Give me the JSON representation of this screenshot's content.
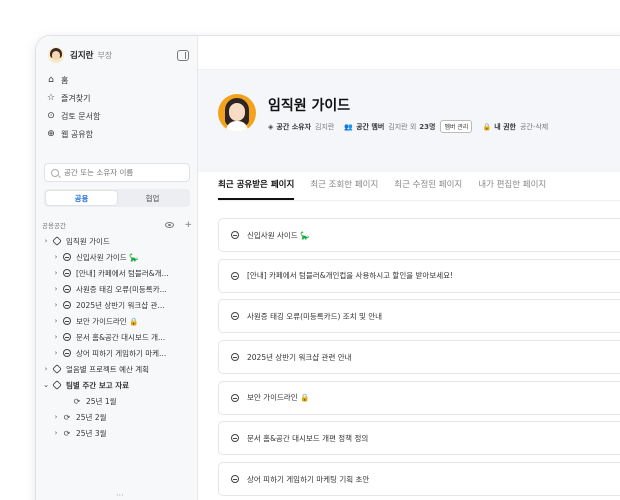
{
  "user": {
    "name": "김지란",
    "title": "부장"
  },
  "nav": [
    {
      "icon": "home-icon",
      "label": "홈"
    },
    {
      "icon": "star-icon",
      "label": "즐겨찾기"
    },
    {
      "icon": "review-icon",
      "label": "검토 문서함"
    },
    {
      "icon": "web-share-icon",
      "label": "웹 공유함"
    }
  ],
  "search": {
    "placeholder": "공간 또는 소유자 이름"
  },
  "segment": {
    "public": "공용",
    "collab": "협업"
  },
  "space_header": "공용공간",
  "tree": [
    {
      "label": "임직원 가이드",
      "chev": "›",
      "icon": "cube"
    },
    {
      "label": "신입사원 가이드 🦕",
      "chev": "›",
      "icon": "doc"
    },
    {
      "label": "[안내] 카페에서 텀블러&개...",
      "chev": "›",
      "icon": "doc"
    },
    {
      "label": "사원증 태깅 오류(미등록카...",
      "chev": "›",
      "icon": "doc"
    },
    {
      "label": "2025년 상반기 워크샵 관...",
      "chev": "›",
      "icon": "doc"
    },
    {
      "label": "보안 가이드라인 🔒",
      "chev": "›",
      "icon": "doc"
    },
    {
      "label": "문서 홈&공간 대시보드 개...",
      "chev": "›",
      "icon": "doc"
    },
    {
      "label": "상어 피하기 게임하기 마케...",
      "chev": "›",
      "icon": "doc"
    },
    {
      "label": "얼음별 프로젝트 예산 계획",
      "chev": "›",
      "icon": "cube"
    },
    {
      "label": "팀별 주간 보고 자료",
      "chev": "⌄",
      "icon": "cube"
    },
    {
      "label": "25년 1월",
      "chev": "",
      "icon": "sync"
    },
    {
      "label": "25년 2월",
      "chev": "›",
      "icon": "sync"
    },
    {
      "label": "25년 3월",
      "chev": "›",
      "icon": "sync"
    }
  ],
  "hero": {
    "title": "임직원 가이드",
    "owner_label": "공간 소유자",
    "owner_name": "김지란",
    "member_label": "공간 멤버",
    "member_text": "김지란 외",
    "member_count": "23명",
    "member_button": "멤버 관리",
    "perm_label": "내 권한",
    "perm_value": "공간-삭제"
  },
  "tabs": [
    "최근 공유받은 페이지",
    "최근 조회한 페이지",
    "최근 수정된 페이지",
    "내가 편집한 페이지"
  ],
  "pages": [
    "신입사원 사이드 🦕",
    "[안내] 카페에서 텀블러&개인컵을 사용하시고 할인을 받아보세요!",
    "사원증 태깅 오류(미등록카드) 조치 및 안내",
    "2025년 상반기 워크샵 관련 안내",
    "보안 가이드라인 🔒",
    "문서 홈&공간 대시보드 개편 정책 정의",
    "상어 피하기 게임하기 마케팅 기획 초안"
  ]
}
